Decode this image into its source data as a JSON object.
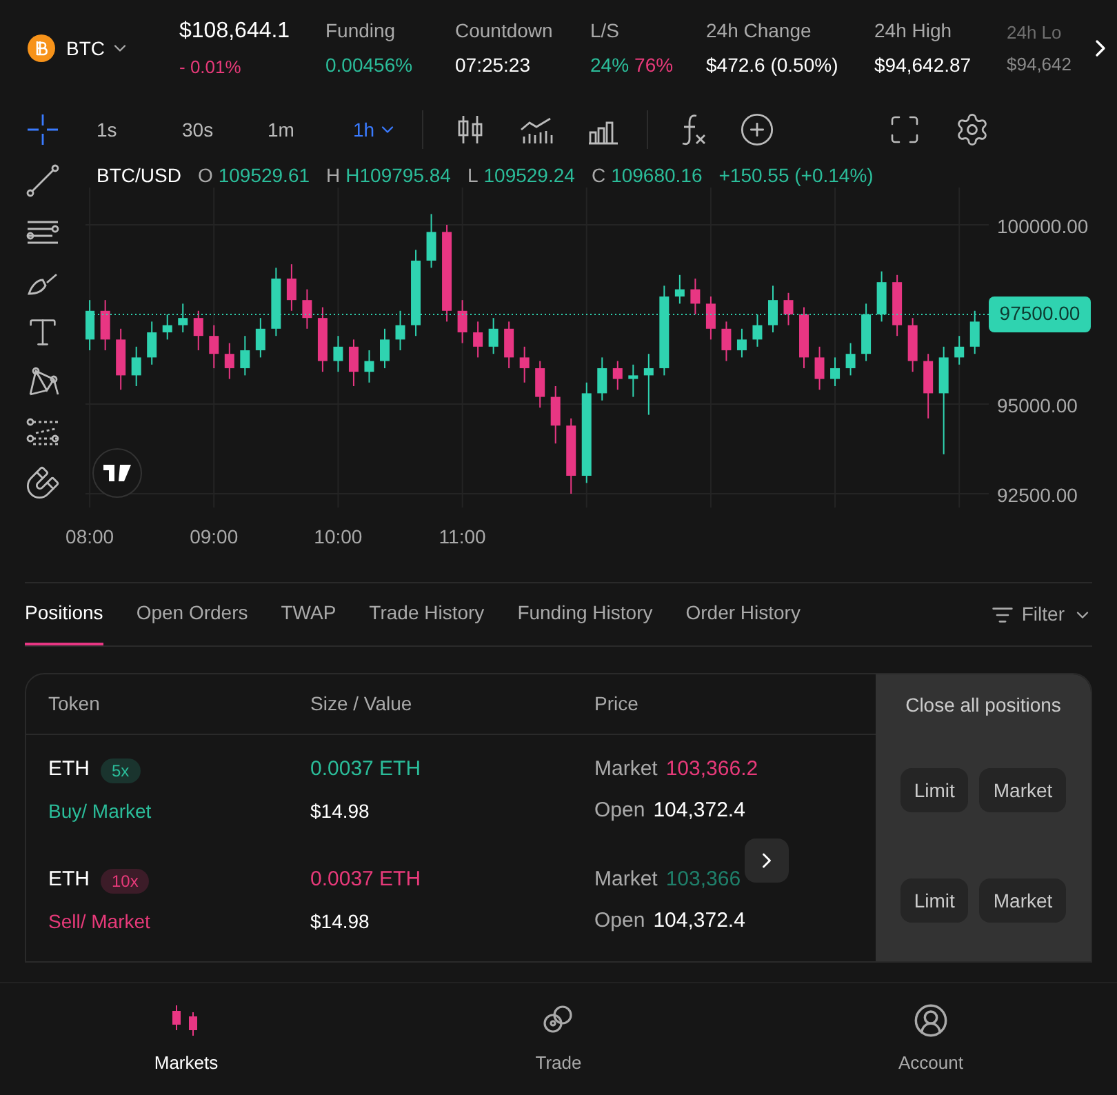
{
  "ticker": {
    "symbol": "BTC",
    "price": "$108,644.1",
    "change": "- 0.01%"
  },
  "stats": [
    {
      "label": "Funding",
      "values": [
        {
          "text": "0.00456%",
          "color": "#2bbd9a"
        }
      ],
      "cut": false
    },
    {
      "label": "Countdown",
      "values": [
        {
          "text": "07:25:23",
          "color": "#ffffff"
        }
      ],
      "cut": false
    },
    {
      "label": "L/S",
      "values": [
        {
          "text": "24%",
          "color": "#2bbd9a"
        },
        {
          "text": "76%",
          "color": "#e83a7a"
        }
      ],
      "cut": false
    },
    {
      "label": "24h Change",
      "values": [
        {
          "text": "$472.6 (0.50%)",
          "color": "#ffffff"
        }
      ],
      "cut": false
    },
    {
      "label": "24h High",
      "values": [
        {
          "text": "$94,642.87",
          "color": "#ffffff"
        }
      ],
      "cut": false
    },
    {
      "label": "24h Lo",
      "values": [
        {
          "text": "$94,642",
          "color": "#8a8a8a"
        }
      ],
      "cut": true
    }
  ],
  "intervals": [
    {
      "label": "1s",
      "selected": false
    },
    {
      "label": "30s",
      "selected": false
    },
    {
      "label": "1m",
      "selected": false
    },
    {
      "label": "1h",
      "selected": true
    }
  ],
  "chart": {
    "pair": "BTC/USD",
    "ohlc_info": [
      {
        "key": "O",
        "value": "109529.61"
      },
      {
        "key": "H",
        "value": "H109795.84"
      },
      {
        "key": "L",
        "value": "109529.24"
      },
      {
        "key": "C",
        "value": "109680.16"
      }
    ],
    "change": "+150.55 (+0.14%)",
    "chart_data": {
      "type": "candlestick",
      "x": [
        8,
        8.125,
        8.25,
        8.375,
        8.5,
        8.625,
        8.75,
        8.875,
        9,
        9.125,
        9.25,
        9.375,
        9.5,
        9.625,
        9.75,
        9.875,
        10,
        10.125,
        10.25,
        10.375,
        10.5,
        10.625,
        10.75,
        10.875,
        11,
        11.125,
        11.25,
        11.375,
        11.5,
        11.625,
        11.75,
        11.875,
        12,
        12.125,
        12.25,
        12.375,
        12.5,
        12.625,
        12.75,
        12.875,
        13,
        13.125,
        13.25,
        13.375,
        13.5,
        13.625,
        13.75,
        13.875,
        14,
        14.125,
        14.25,
        14.375,
        14.5,
        14.625,
        14.75,
        14.875,
        15,
        15.125
      ],
      "ohlc": [
        [
          96800,
          97900,
          96500,
          97600
        ],
        [
          97600,
          97900,
          96500,
          96800
        ],
        [
          96800,
          97100,
          95400,
          95800
        ],
        [
          95800,
          96600,
          95500,
          96300
        ],
        [
          96300,
          97300,
          96100,
          97000
        ],
        [
          97000,
          97500,
          96800,
          97200
        ],
        [
          97200,
          97800,
          97000,
          97400
        ],
        [
          97400,
          97600,
          96500,
          96900
        ],
        [
          96900,
          97200,
          96000,
          96400
        ],
        [
          96400,
          96700,
          95700,
          96000
        ],
        [
          96000,
          96900,
          95800,
          96500
        ],
        [
          96500,
          97400,
          96300,
          97100
        ],
        [
          97100,
          98800,
          96900,
          98500
        ],
        [
          98500,
          98900,
          97600,
          97900
        ],
        [
          97900,
          98200,
          97100,
          97400
        ],
        [
          97400,
          97700,
          95900,
          96200
        ],
        [
          96200,
          96900,
          95900,
          96600
        ],
        [
          96600,
          96800,
          95500,
          95900
        ],
        [
          95900,
          96500,
          95600,
          96200
        ],
        [
          96200,
          97100,
          96000,
          96800
        ],
        [
          96800,
          97600,
          96500,
          97200
        ],
        [
          97200,
          99300,
          96900,
          99000
        ],
        [
          99000,
          100300,
          98800,
          99800
        ],
        [
          99800,
          100000,
          97300,
          97600
        ],
        [
          97600,
          97900,
          96700,
          97000
        ],
        [
          97000,
          97300,
          96300,
          96600
        ],
        [
          96600,
          97400,
          96400,
          97100
        ],
        [
          97100,
          97300,
          96000,
          96300
        ],
        [
          96300,
          96600,
          95600,
          96000
        ],
        [
          96000,
          96200,
          94900,
          95200
        ],
        [
          95200,
          95500,
          93900,
          94400
        ],
        [
          94400,
          94600,
          92500,
          93000
        ],
        [
          93000,
          95600,
          92800,
          95300
        ],
        [
          95300,
          96300,
          95100,
          96000
        ],
        [
          96000,
          96200,
          95400,
          95700
        ],
        [
          95700,
          96100,
          95200,
          95800
        ],
        [
          95800,
          96400,
          94700,
          96000
        ],
        [
          96000,
          98300,
          95800,
          98000
        ],
        [
          98000,
          98600,
          97800,
          98200
        ],
        [
          98200,
          98500,
          97500,
          97800
        ],
        [
          97800,
          98000,
          96800,
          97100
        ],
        [
          97100,
          97300,
          96200,
          96500
        ],
        [
          96500,
          97100,
          96300,
          96800
        ],
        [
          96800,
          97500,
          96600,
          97200
        ],
        [
          97200,
          98300,
          97000,
          97900
        ],
        [
          97900,
          98100,
          97200,
          97500
        ],
        [
          97500,
          97700,
          96000,
          96300
        ],
        [
          96300,
          96600,
          95400,
          95700
        ],
        [
          95700,
          96300,
          95500,
          96000
        ],
        [
          96000,
          96700,
          95800,
          96400
        ],
        [
          96400,
          97800,
          96200,
          97500
        ],
        [
          97500,
          98700,
          97300,
          98400
        ],
        [
          98400,
          98600,
          96900,
          97200
        ],
        [
          97200,
          97400,
          95900,
          96200
        ],
        [
          96200,
          96400,
          94600,
          95300
        ],
        [
          95300,
          96600,
          93600,
          96300
        ],
        [
          96300,
          96900,
          96100,
          96600
        ],
        [
          96600,
          97600,
          96400,
          97300
        ]
      ],
      "xlim": [
        7.966,
        15.2375
      ],
      "ylim": [
        92115,
        101038
      ],
      "grid": true,
      "ref_lines": [
        {
          "axis": "y",
          "value": 97500,
          "label": "97500.00",
          "color": "#2fd3b0"
        }
      ],
      "xticks": [
        {
          "value": 8,
          "label": "08:00"
        },
        {
          "value": 9,
          "label": "09:00"
        },
        {
          "value": 10,
          "label": "10:00"
        },
        {
          "value": 11,
          "label": "11:00"
        }
      ],
      "yticks": [
        {
          "value": 100000,
          "label": "100000.00"
        },
        {
          "value": 95000,
          "label": "95000.00"
        },
        {
          "value": 92500,
          "label": "92500.00"
        }
      ]
    }
  },
  "tabs": [
    {
      "label": "Positions",
      "selected": true
    },
    {
      "label": "Open Orders",
      "selected": false
    },
    {
      "label": "TWAP",
      "selected": false
    },
    {
      "label": "Trade History",
      "selected": false
    },
    {
      "label": "Funding History",
      "selected": false
    },
    {
      "label": "Order History",
      "selected": false
    }
  ],
  "filter": "Filter",
  "table": {
    "columns": [
      "Token",
      "Size / Value",
      "Price"
    ],
    "close_all": "Close all positions",
    "rows": [
      {
        "token": "ETH",
        "leverage": "5x",
        "color": "#2bbd9a",
        "order": "Buy/ Market",
        "size": "0.0037 ETH",
        "value": "$14.98",
        "market": {
          "label": "Market",
          "price": "103,366.2",
          "color": "#e83a7a"
        },
        "open_label": "Open",
        "open_price": "104,372.4",
        "actions": [
          "Limit",
          "Market"
        ]
      },
      {
        "token": "ETH",
        "leverage": "10x",
        "color": "#e83a7a",
        "order": "Sell/ Market",
        "size": "0.0037 ETH",
        "value": "$14.98",
        "market": {
          "label": "Market",
          "price": "103,366",
          "color": "#1f7f6a"
        },
        "open_label": "Open",
        "open_price": "104,372.4",
        "actions": [
          "Limit",
          "Market"
        ]
      }
    ]
  },
  "nav": [
    {
      "label": "Markets",
      "kind": "candles",
      "selected": true
    },
    {
      "label": "Trade",
      "kind": "trade",
      "selected": false
    },
    {
      "label": "Account",
      "kind": "account",
      "selected": false
    }
  ]
}
